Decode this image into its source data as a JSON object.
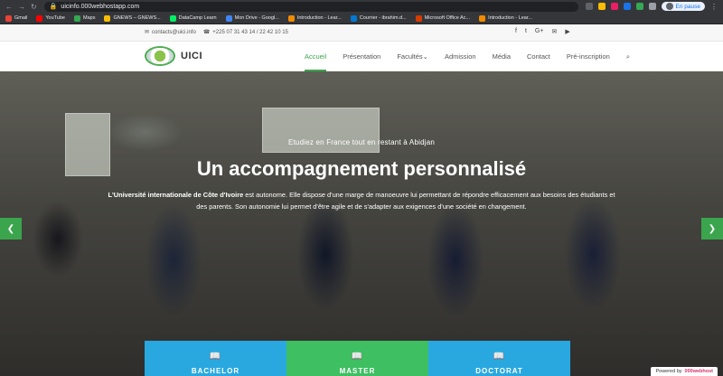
{
  "browser": {
    "url": "uicinfo.000webhostapp.com",
    "profile_status": "En pause",
    "bookmarks": [
      {
        "label": "Gmail",
        "color": "#ea4335"
      },
      {
        "label": "YouTube",
        "color": "#ff0000"
      },
      {
        "label": "Maps",
        "color": "#34a853"
      },
      {
        "label": "GNEWS – GNEWS...",
        "color": "#fbbc05"
      },
      {
        "label": "DataCamp Learn",
        "color": "#03ef62"
      },
      {
        "label": "Mon Drive - Googl...",
        "color": "#4285f4"
      },
      {
        "label": "Introduction - Lear...",
        "color": "#f28b00"
      },
      {
        "label": "Courrier - ibrahim.d...",
        "color": "#0078d4"
      },
      {
        "label": "Microsoft Office Ac...",
        "color": "#d83b01"
      },
      {
        "label": "Introduction - Lear...",
        "color": "#f28b00"
      }
    ]
  },
  "topbar": {
    "email": "contacts@uici.info",
    "phone": "+225 07 31 43 14 / 22 42 10 15"
  },
  "header": {
    "logo_text": "UICI",
    "nav": [
      {
        "label": "Accueil",
        "active": true
      },
      {
        "label": "Présentation",
        "active": false
      },
      {
        "label": "Facultés",
        "active": false
      },
      {
        "label": "Admission",
        "active": false
      },
      {
        "label": "Média",
        "active": false
      },
      {
        "label": "Contact",
        "active": false
      },
      {
        "label": "Pré-inscription",
        "active": false
      }
    ]
  },
  "hero": {
    "subtitle": "Etudiez en France tout en restant à Abidjan",
    "title": "Un accompagnement personnalisé",
    "text_bold": "L'Université internationale de Côte d'Ivoire",
    "text_rest": " est autonome. Elle dispose d'une marge de manoeuvre lui permettant de répondre efficacement aux besoins des étudiants et des parents. Son autonomie lui permet d'être agile et de s'adapter aux exigences d'une société en changement."
  },
  "cards": [
    {
      "label": "BACHELOR",
      "color": "#29a8e0"
    },
    {
      "label": "MASTER",
      "color": "#3dbf62"
    },
    {
      "label": "DOCTORAT",
      "color": "#29a8e0"
    }
  ],
  "powered": {
    "prefix": "Powered by",
    "brand": "000webhost"
  }
}
